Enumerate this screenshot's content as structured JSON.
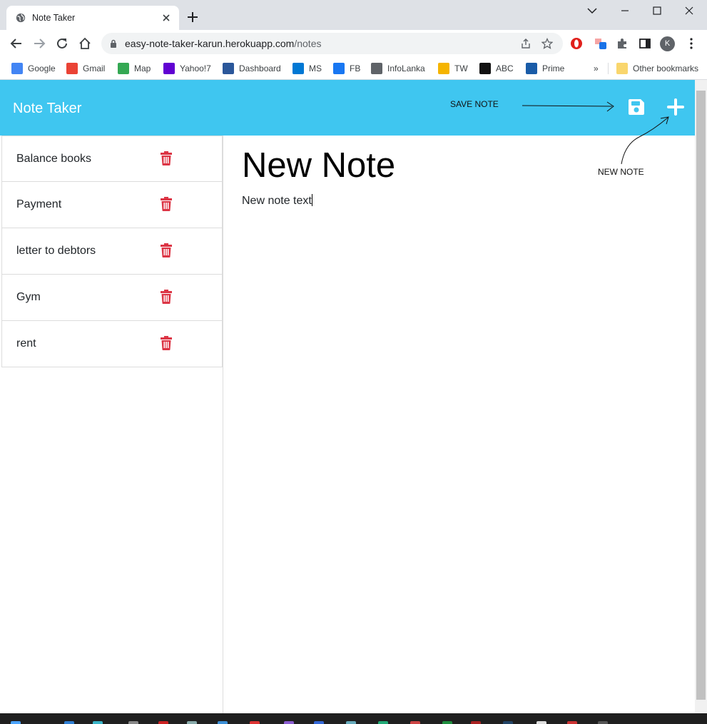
{
  "browser": {
    "tab_title": "Note Taker",
    "url_host": "easy-note-taker-karun.herokuapp.com",
    "url_path": "/notes",
    "profile_initial": "K",
    "extension_badge": "1"
  },
  "bookmarks": [
    {
      "label": "Google",
      "icon": "google-icon",
      "color": "#4285f4"
    },
    {
      "label": "Gmail",
      "icon": "gmail-icon",
      "color": "#ea4335"
    },
    {
      "label": "Map",
      "icon": "maps-icon",
      "color": "#34a853"
    },
    {
      "label": "Yahoo!7",
      "icon": "yahoo-icon",
      "color": "#6001d2"
    },
    {
      "label": "Dashboard",
      "icon": "dashboard-icon",
      "color": "#2b579a"
    },
    {
      "label": "MS",
      "icon": "outlook-icon",
      "color": "#0078d4"
    },
    {
      "label": "FB",
      "icon": "facebook-icon",
      "color": "#1877f2"
    },
    {
      "label": "InfoLanka",
      "icon": "globe-icon",
      "color": "#5f6368"
    },
    {
      "label": "TW",
      "icon": "tw-icon",
      "color": "#f5b400"
    },
    {
      "label": "ABC",
      "icon": "abc-icon",
      "color": "#111111"
    },
    {
      "label": "Prime",
      "icon": "prime-icon",
      "color": "#1a5ca8"
    }
  ],
  "bookmarks_overflow": "»",
  "other_bookmarks": "Other bookmarks",
  "app": {
    "brand": "Note Taker",
    "accent": "#3fc6f0",
    "delete_color": "#dc3545",
    "save_annotation": "SAVE NOTE",
    "new_annotation": "NEW NOTE"
  },
  "notes": [
    {
      "title": "Balance books"
    },
    {
      "title": "Payment"
    },
    {
      "title": "letter to debtors"
    },
    {
      "title": "Gym"
    },
    {
      "title": "rent"
    }
  ],
  "editor": {
    "title": "New Note",
    "text": "New note text"
  }
}
